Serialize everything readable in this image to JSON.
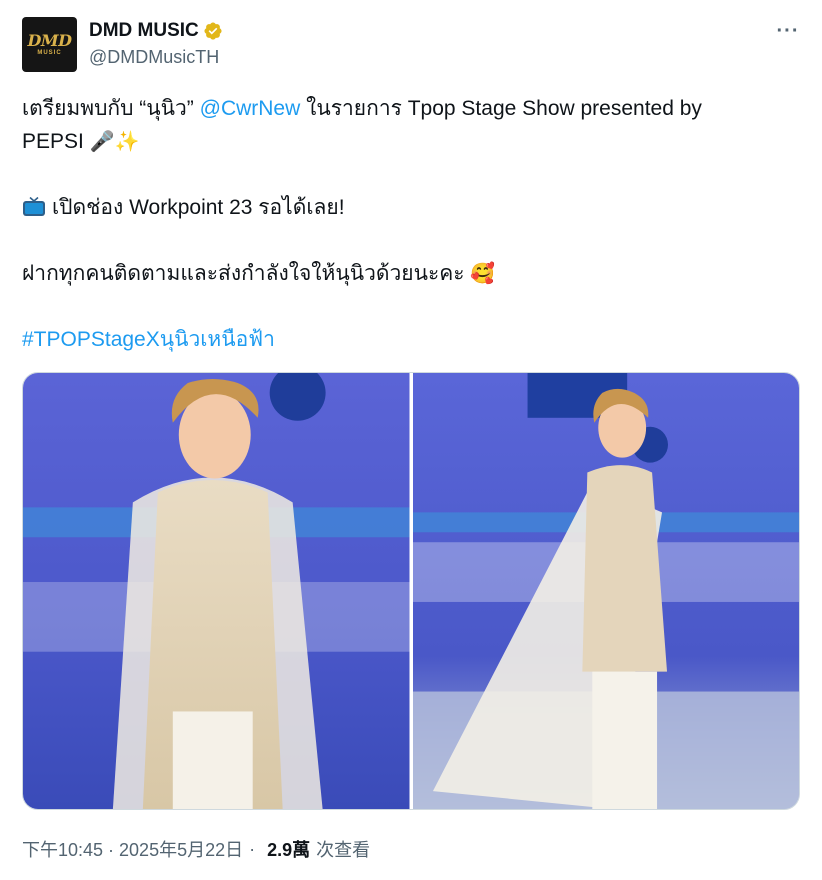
{
  "account": {
    "display_name": "DMD MUSIC",
    "handle": "@DMDMusicTH",
    "avatar_logo_main": "DMD",
    "avatar_logo_sub": "MUSIC"
  },
  "tweet": {
    "line1_prefix": "เตรียมพบกับ “นุนิว” ",
    "mention": "@CwrNew",
    "line1_suffix": " ในรายการ Tpop Stage Show presented by",
    "line2": "PEPSI ",
    "line2_emoji": "🎤✨",
    "line3": "เปิดช่อง Workpoint 23 รอได้เลย!",
    "line4": "ฝากทุกคนติดตามและส่งกำลังใจให้นุนิวด้วยนะคะ ",
    "line4_emoji": "🥰",
    "hashtag": "#TPOPStageXนุนิวเหนือฟ้า"
  },
  "meta": {
    "timestamp": "下午10:45 · 2025年5月22日",
    "separator": "·",
    "views_count": "2.9萬",
    "views_label": "次查看"
  },
  "icons": {
    "verified": "verified-badge-icon",
    "more": "more-options-icon",
    "tv": "television-icon"
  },
  "colors": {
    "link": "#1d9bf0",
    "secondary_text": "#536471",
    "verified_gold": "#e2b719"
  }
}
